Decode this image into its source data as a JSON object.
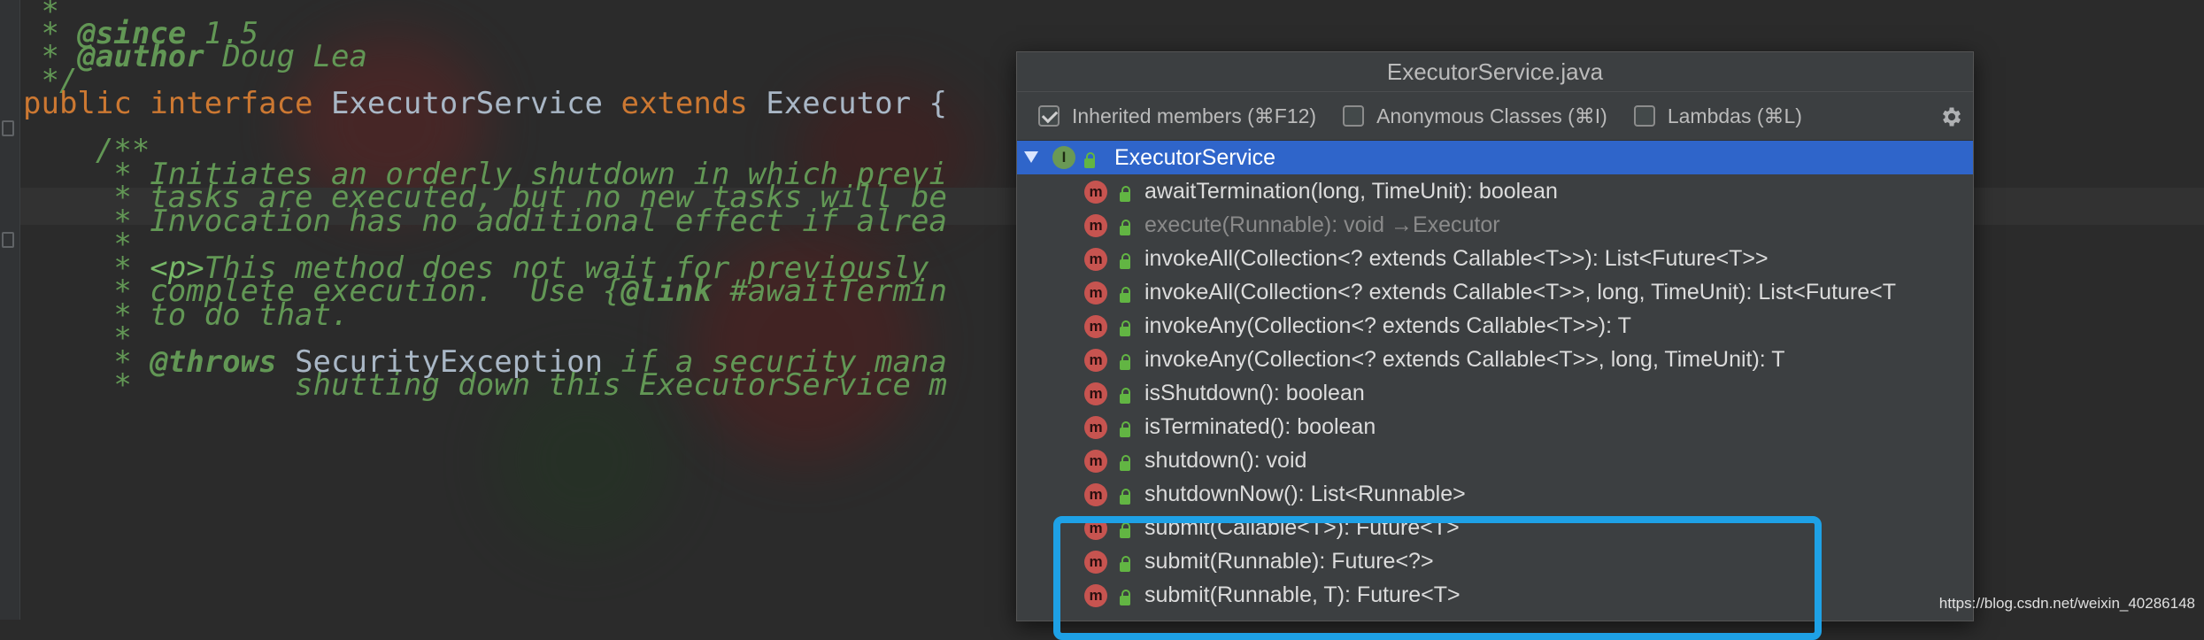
{
  "editor": {
    "lines": [
      {
        "segments": [
          {
            "t": " *",
            "c": "c-doc"
          }
        ]
      },
      {
        "segments": [
          {
            "t": " * ",
            "c": "c-doc"
          },
          {
            "t": "@since",
            "c": "c-tag"
          },
          {
            "t": " 1.5",
            "c": "c-doc"
          }
        ]
      },
      {
        "segments": [
          {
            "t": " * ",
            "c": "c-doc"
          },
          {
            "t": "@author",
            "c": "c-tag"
          },
          {
            "t": " Doug Lea",
            "c": "c-doc"
          }
        ]
      },
      {
        "segments": [
          {
            "t": " */",
            "c": "c-doc"
          }
        ]
      },
      {
        "segments": [
          {
            "t": "public interface",
            "c": "c-kw"
          },
          {
            "t": " ExecutorService ",
            "c": "c-id"
          },
          {
            "t": "extends",
            "c": "c-kw"
          },
          {
            "t": " Executor {",
            "c": "c-id"
          }
        ]
      },
      {
        "segments": [
          {
            "t": "",
            "c": "c-id"
          }
        ]
      },
      {
        "segments": [
          {
            "t": "    /**",
            "c": "c-doc"
          }
        ]
      },
      {
        "segments": [
          {
            "t": "     * Initiates an orderly shutdown in which previ",
            "c": "c-doc"
          }
        ]
      },
      {
        "segments": [
          {
            "t": "     * tasks are executed, but no new tasks will be",
            "c": "c-doc"
          }
        ]
      },
      {
        "segments": [
          {
            "t": "     * Invocation has no additional effect if alrea",
            "c": "c-doc"
          }
        ]
      },
      {
        "segments": [
          {
            "t": "     *",
            "c": "c-doc"
          }
        ]
      },
      {
        "segments": [
          {
            "t": "     * ",
            "c": "c-doc"
          },
          {
            "t": "<p>",
            "c": "c-html"
          },
          {
            "t": "This method does not wait for previously",
            "c": "c-doc"
          }
        ]
      },
      {
        "segments": [
          {
            "t": "     * complete execution.  Use {",
            "c": "c-doc"
          },
          {
            "t": "@link",
            "c": "c-tag"
          },
          {
            "t": " #awaitTermin",
            "c": "c-doc"
          }
        ]
      },
      {
        "segments": [
          {
            "t": "     * to do that.",
            "c": "c-doc"
          }
        ]
      },
      {
        "segments": [
          {
            "t": "     *",
            "c": "c-doc"
          }
        ]
      },
      {
        "segments": [
          {
            "t": "     * ",
            "c": "c-doc"
          },
          {
            "t": "@throws",
            "c": "c-tag"
          },
          {
            "t": " SecurityException ",
            "c": "c-id"
          },
          {
            "t": "if a security mana",
            "c": "c-doc"
          }
        ]
      },
      {
        "segments": [
          {
            "t": "     *         shutting down this ExecutorService m",
            "c": "c-doc"
          }
        ]
      }
    ]
  },
  "popup": {
    "title": "ExecutorService.java",
    "options": [
      {
        "label": "Inherited members (⌘F12)",
        "checked": true
      },
      {
        "label": "Anonymous Classes (⌘I)",
        "checked": false
      },
      {
        "label": "Lambdas (⌘L)",
        "checked": false
      }
    ],
    "gear_icon": "gear-icon",
    "root": {
      "label": "ExecutorService",
      "icon": "interface-icon",
      "icon_letter": "I"
    },
    "method_icon_letter": "m",
    "members": [
      {
        "label": "awaitTermination(long, TimeUnit): boolean",
        "inherited": false
      },
      {
        "label": "execute(Runnable): void →Executor",
        "inherited": true
      },
      {
        "label": "invokeAll(Collection<? extends Callable<T>>): List<Future<T>>",
        "inherited": false
      },
      {
        "label": "invokeAll(Collection<? extends Callable<T>>, long, TimeUnit): List<Future<T",
        "inherited": false
      },
      {
        "label": "invokeAny(Collection<? extends Callable<T>>): T",
        "inherited": false
      },
      {
        "label": "invokeAny(Collection<? extends Callable<T>>, long, TimeUnit): T",
        "inherited": false
      },
      {
        "label": "isShutdown(): boolean",
        "inherited": false
      },
      {
        "label": "isTerminated(): boolean",
        "inherited": false
      },
      {
        "label": "shutdown(): void",
        "inherited": false
      },
      {
        "label": "shutdownNow(): List<Runnable>",
        "inherited": false
      },
      {
        "label": "submit(Callable<T>): Future<T>",
        "inherited": false
      },
      {
        "label": "submit(Runnable): Future<?>",
        "inherited": false
      },
      {
        "label": "submit(Runnable, T): Future<T>",
        "inherited": false
      }
    ]
  },
  "colors": {
    "selection": "#2f65ca",
    "highlight_box": "#1ea1e6",
    "method_icon": "#c75450",
    "interface_icon": "#6a9955"
  },
  "watermark": "https://blog.csdn.net/weixin_40286148"
}
